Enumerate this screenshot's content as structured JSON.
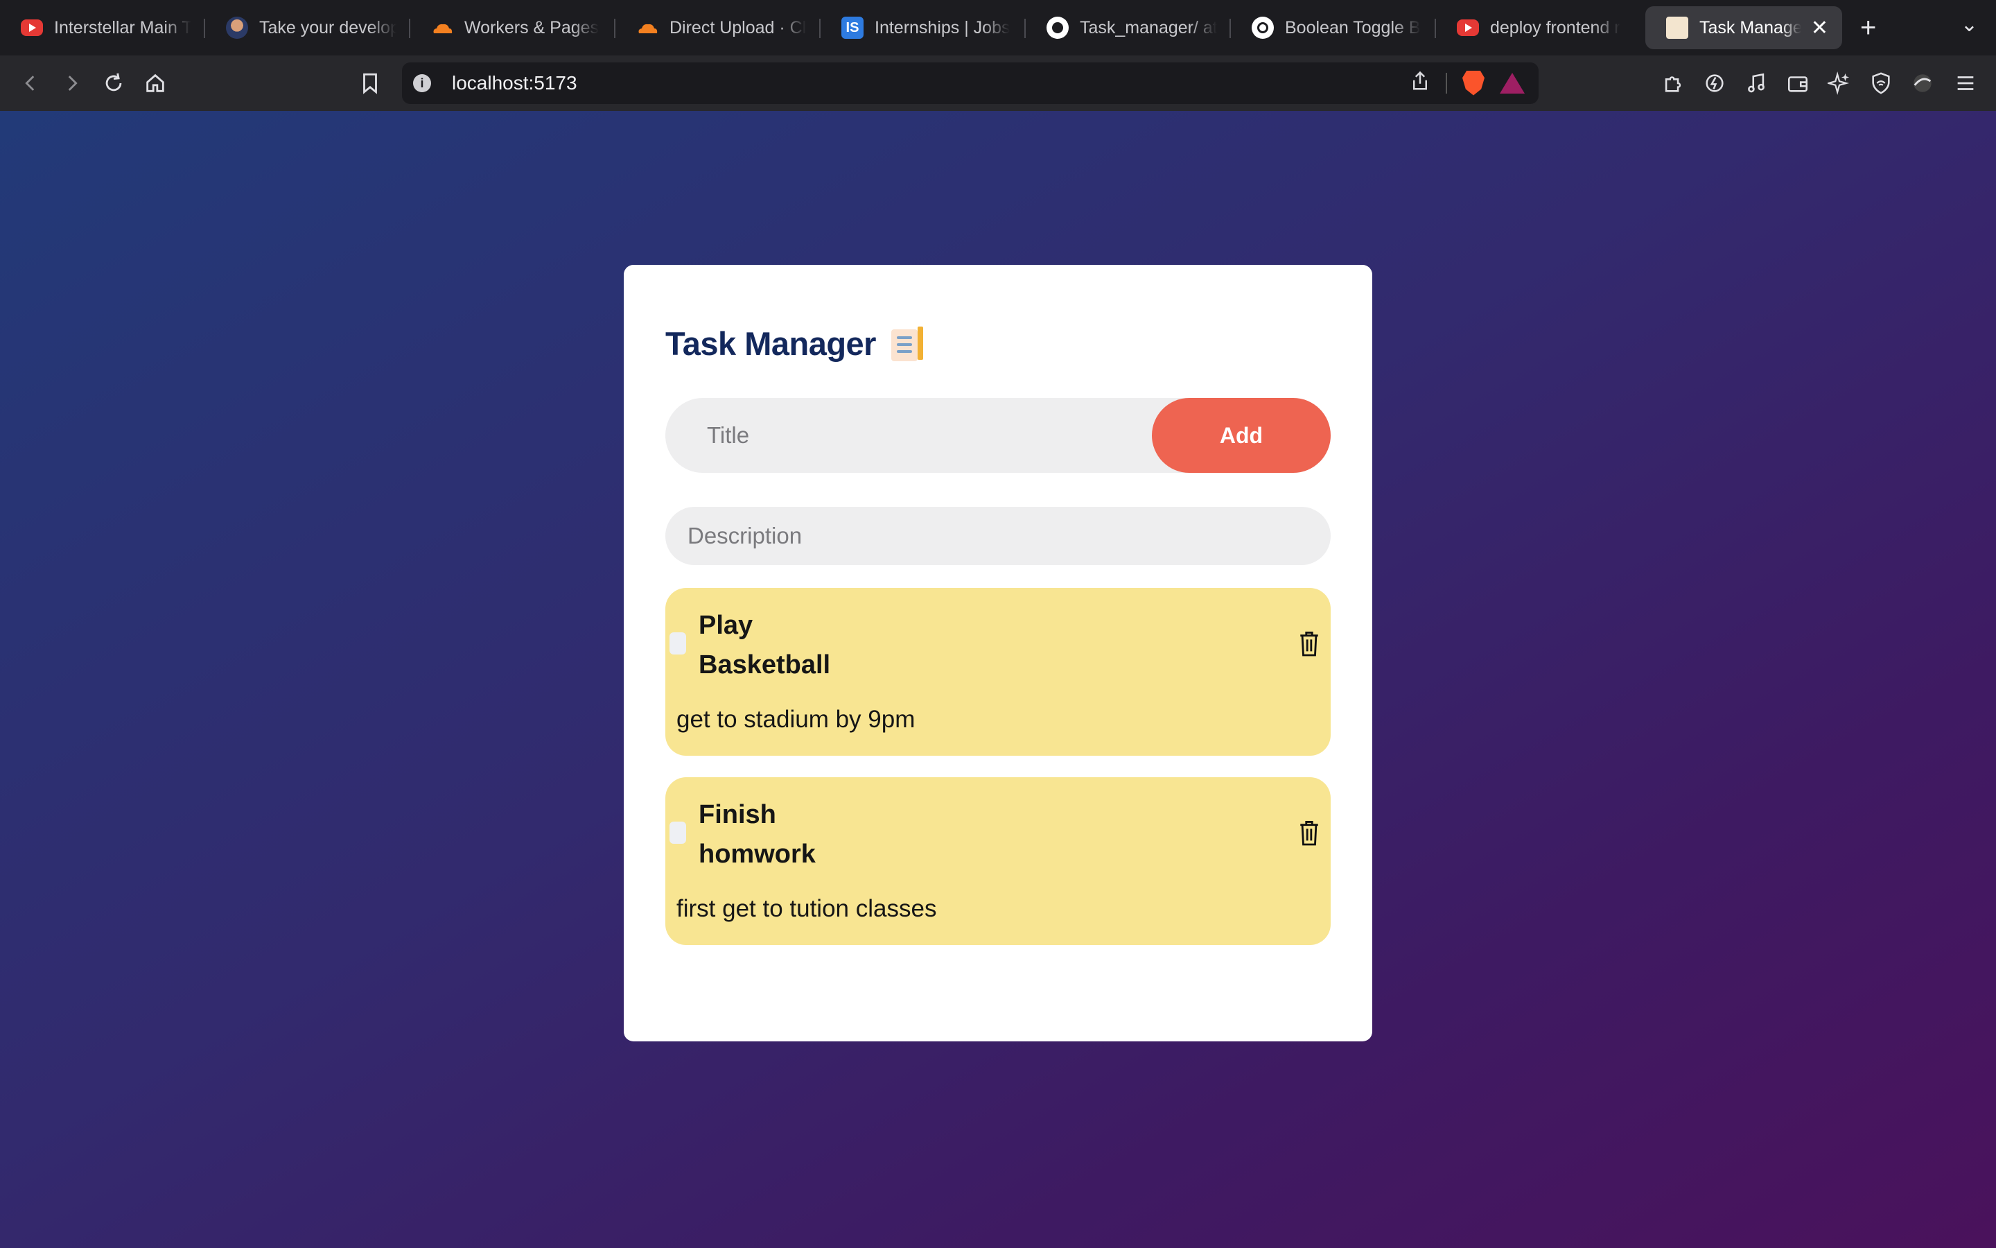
{
  "browser": {
    "tabs": [
      {
        "label": "Interstellar Main Theme",
        "icon": "youtube-icon"
      },
      {
        "label": "Take your developer",
        "icon": "avatar-icon"
      },
      {
        "label": "Workers & Pages",
        "icon": "cloudflare-icon"
      },
      {
        "label": "Direct Upload · Cloudflare",
        "icon": "cloudflare-icon"
      },
      {
        "label": "Internships | Jobs",
        "icon": "internshala-icon"
      },
      {
        "label": "Task_manager/ at",
        "icon": "github-icon"
      },
      {
        "label": "Boolean Toggle B",
        "icon": "openai-icon"
      },
      {
        "label": "deploy frontend r",
        "icon": "youtube-icon"
      },
      {
        "label": "Task Manager",
        "icon": "task-manager-favicon",
        "active": true
      }
    ],
    "url": "localhost:5173"
  },
  "app": {
    "title": "Task Manager",
    "title_placeholder": "Title",
    "title_value": "",
    "add_label": "Add",
    "description_placeholder": "Description",
    "description_value": "",
    "tasks": [
      {
        "title": "Play Basketball",
        "description": "get to stadium by 9pm",
        "completed": false
      },
      {
        "title": "Finish homwork",
        "description": "first get to tution classes",
        "completed": false
      }
    ]
  },
  "colors": {
    "accent": "#ee6451",
    "title": "#13285c",
    "task_card": "#f8e592",
    "input_bg": "#eeeeef"
  }
}
